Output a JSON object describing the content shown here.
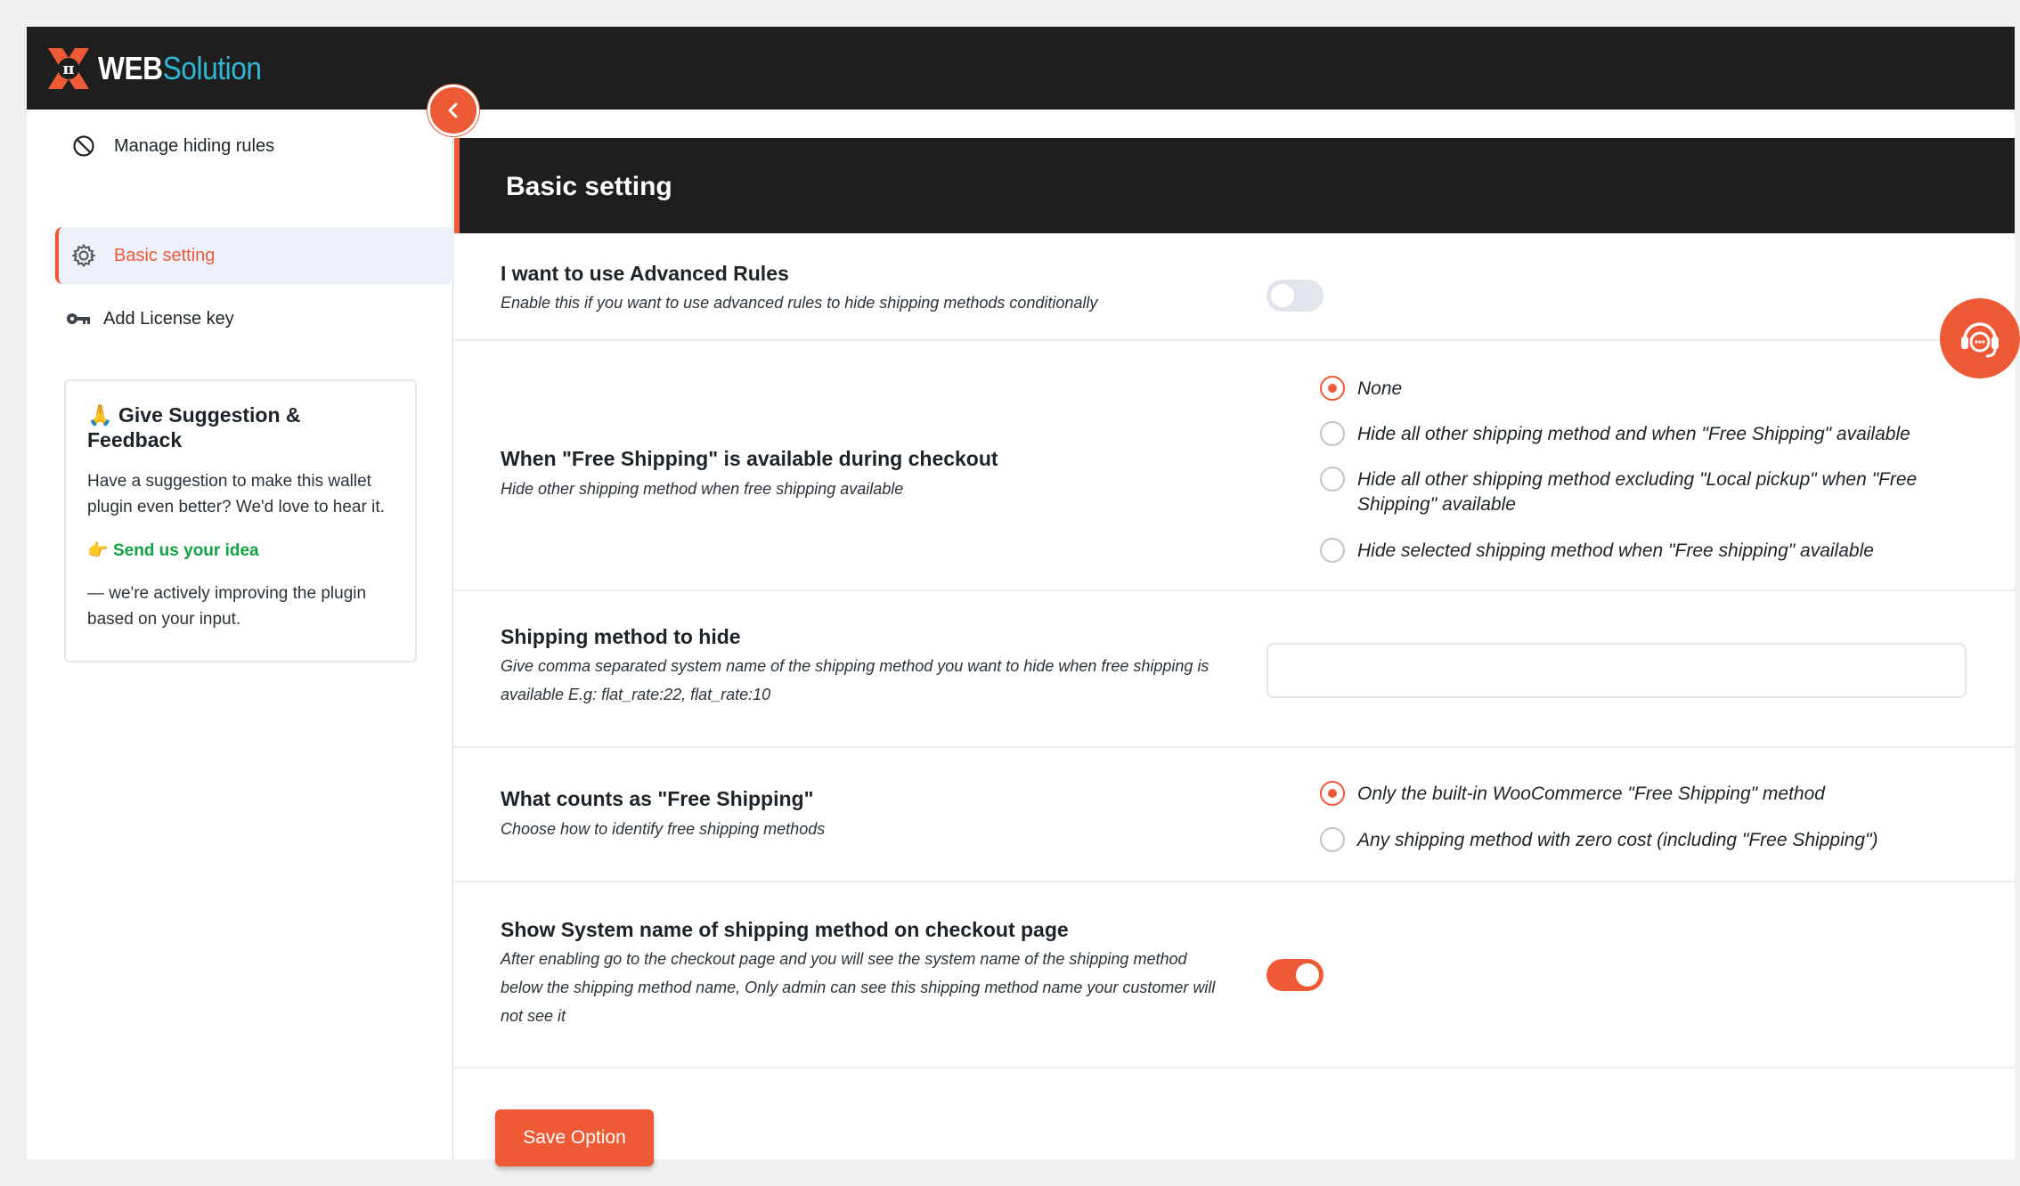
{
  "brand": {
    "web": "WEB",
    "solution": "Solution"
  },
  "sidebar": {
    "items": [
      {
        "label": "Manage hiding rules",
        "icon": "prohibited-icon"
      },
      {
        "label": "Basic setting",
        "icon": "gear-icon",
        "active": true
      },
      {
        "label": "Add License key",
        "icon": "key-icon"
      }
    ],
    "feedback": {
      "emoji": "🙏",
      "title": "Give Suggestion & Feedback",
      "text": "Have a suggestion to make this wallet plugin even better? We'd love to hear it.",
      "link_emoji": "👉",
      "link": "Send us your idea",
      "footer": "— we're actively improving the plugin based on your input."
    }
  },
  "page": {
    "title": "Basic setting"
  },
  "settings": {
    "advanced_rules": {
      "title": "I want to use Advanced Rules",
      "desc": "Enable this if you want to use advanced rules to hide shipping methods conditionally",
      "enabled": false
    },
    "free_shipping": {
      "title": "When \"Free Shipping\" is available during checkout",
      "desc": "Hide other shipping method when free shipping available",
      "options": [
        "None",
        "Hide all other shipping method and when \"Free Shipping\" available",
        "Hide all other shipping method excluding \"Local pickup\" when \"Free Shipping\" available",
        "Hide selected shipping method when \"Free shipping\" available"
      ],
      "selected": 0
    },
    "method_to_hide": {
      "title": "Shipping method to hide",
      "desc": "Give comma separated system name of the shipping method you want to hide when free shipping is available E.g: flat_rate:22, flat_rate:10",
      "value": "",
      "placeholder": ""
    },
    "counts_as_free": {
      "title": "What counts as \"Free Shipping\"",
      "desc": "Choose how to identify free shipping methods",
      "options": [
        "Only the built-in WooCommerce \"Free Shipping\" method",
        "Any shipping method with zero cost (including \"Free Shipping\")"
      ],
      "selected": 0
    },
    "show_system_name": {
      "title": "Show System name of shipping method on checkout page",
      "desc": "After enabling go to the checkout page and you will see the system name of the shipping method below the shipping method name, Only admin can see this shipping method name your customer will not see it",
      "enabled": true
    }
  },
  "actions": {
    "save_label": "Save Option"
  },
  "colors": {
    "accent": "#ee5a36",
    "header_bg": "#1e1e1e",
    "link_green": "#10a243",
    "brand_blue": "#2eb8d8"
  }
}
